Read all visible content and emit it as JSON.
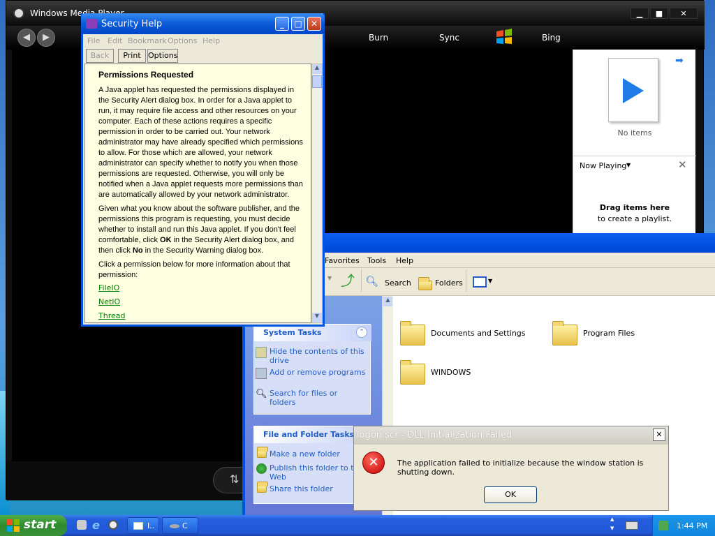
{
  "wmp": {
    "title": "Windows Media Player",
    "tabs": [
      "Burn",
      "Sync",
      "Bing"
    ],
    "playlist": {
      "no_items": "No items",
      "now_playing": "Now Playing",
      "drag_title": "Drag items here",
      "drag_sub": "to create a playlist."
    }
  },
  "security_help": {
    "title": "Security Help",
    "menus": [
      "File",
      "Edit",
      "Bookmark",
      "Options",
      "Help"
    ],
    "buttons": [
      "Back",
      "Print",
      "Options"
    ],
    "heading": "Permissions Requested",
    "para1": "A Java applet has requested the permissions displayed in the Security Alert dialog box. In order for a Java applet to run, it may require file access and other resources on your computer. Each of these actions requires a specific permission in order to be carried out. Your network administrator may have already specified which permissions to allow. For those which are allowed, your network administrator can specify whether to notify you when those permissions are requested. Otherwise, you will only be notified when a Java applet requests more permissions than are automatically allowed by your network administrator.",
    "para2a": "Given what you know about the software publisher, and the permissions this program is requesting, you must decide whether to install and run this Java applet. If you don't feel comfortable, click ",
    "para2_ok": "OK",
    "para2b": " in the Security Alert dialog box, and then click ",
    "para2_no": "No",
    "para2c": " in the Security Warning dialog box.",
    "para3": "Click a permission below for more information about that permission:",
    "links": [
      "FileIO",
      "NetIO",
      "Thread"
    ]
  },
  "explorer": {
    "menus": [
      "Favorites",
      "Tools",
      "Help"
    ],
    "toolbar": {
      "search": "Search",
      "folders": "Folders"
    },
    "system_tasks": {
      "title": "System Tasks",
      "items": [
        "Hide the contents of this drive",
        "Add or remove programs",
        "Search for files or folders"
      ]
    },
    "file_tasks": {
      "title": "File and Folder Tasks",
      "items": [
        "Make a new folder",
        "Publish this folder to the Web",
        "Share this folder"
      ]
    },
    "folders": [
      "Documents and Settings",
      "Program Files",
      "WINDOWS"
    ]
  },
  "error_dialog": {
    "title": "logon.scr - DLL Initialization Failed",
    "message": "The application failed to initialize because the window station is shutting down.",
    "ok": "OK"
  },
  "taskbar": {
    "start": "start",
    "tasks": [
      "I..",
      "C"
    ],
    "clock": "1:44 PM"
  }
}
